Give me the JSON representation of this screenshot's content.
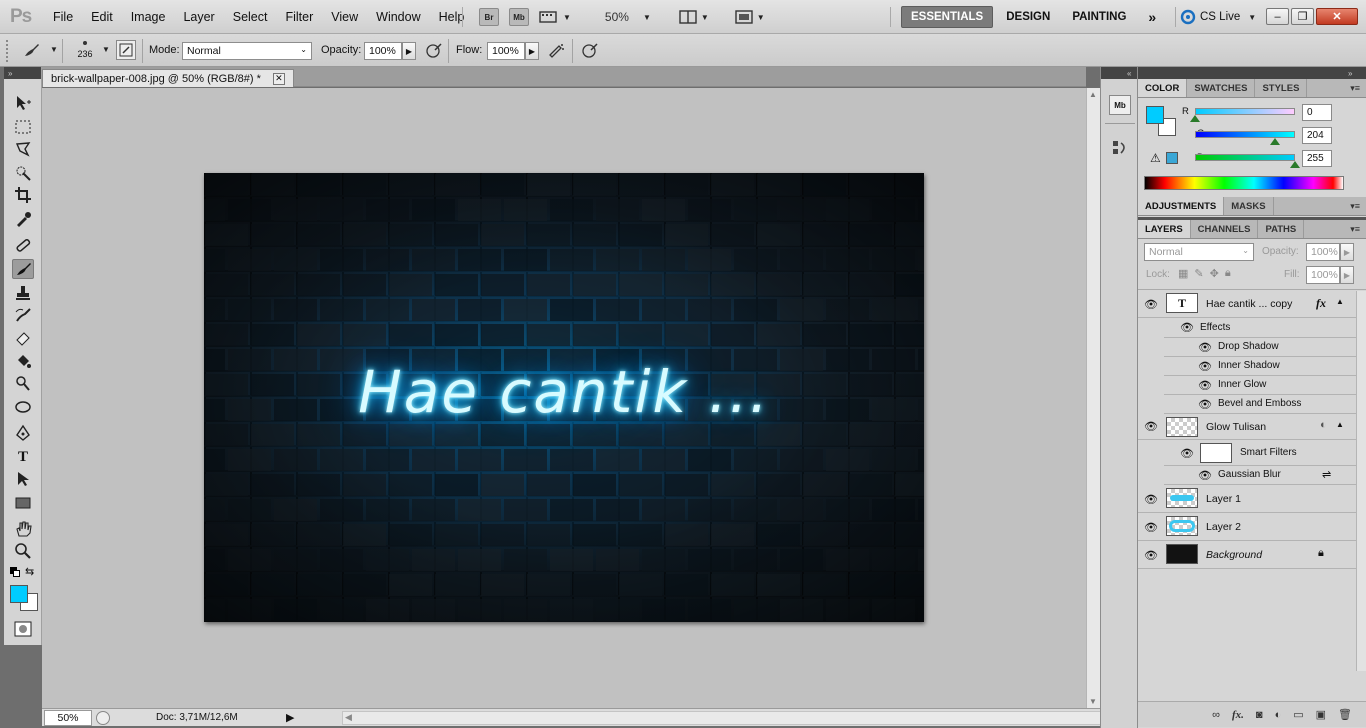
{
  "app": {
    "logo": "Ps"
  },
  "menu": [
    "File",
    "Edit",
    "Image",
    "Layer",
    "Select",
    "Filter",
    "View",
    "Window",
    "Help"
  ],
  "menubar": {
    "bridge_btn": "Br",
    "minibridge_btn": "Mb",
    "zoom": "50%",
    "workspaces": [
      "ESSENTIALS",
      "DESIGN",
      "PAINTING"
    ],
    "more": "»",
    "cslive": "CS Live",
    "window_buttons": [
      "–",
      "❐",
      "✕"
    ]
  },
  "options": {
    "brush_size": "236",
    "mode_label": "Mode:",
    "mode_value": "Normal",
    "opacity_label": "Opacity:",
    "opacity_value": "100%",
    "flow_label": "Flow:",
    "flow_value": "100%"
  },
  "document": {
    "tab_title": "brick-wallpaper-008.jpg @ 50% (RGB/8#) *",
    "close": "✕",
    "canvas_text": "Hae cantik ..."
  },
  "status": {
    "zoom": "50%",
    "doc_size": "Doc: 3,71M/12,6M"
  },
  "color_panel": {
    "tabs": [
      "COLOR",
      "SWATCHES",
      "STYLES"
    ],
    "r_label": "R",
    "r_value": "0",
    "r": 0,
    "g_label": "G",
    "g_value": "204",
    "g": 204,
    "b_label": "B",
    "b_value": "255",
    "b": 255,
    "fg_color": "#00ccff"
  },
  "adjustments_panel": {
    "tabs": [
      "ADJUSTMENTS",
      "MASKS"
    ]
  },
  "layers_panel": {
    "tabs": [
      "LAYERS",
      "CHANNELS",
      "PATHS"
    ],
    "blend_mode": "Normal",
    "opacity_label": "Opacity:",
    "opacity_value": "100%",
    "lock_label": "Lock:",
    "fill_label": "Fill:",
    "fill_value": "100%",
    "layers": [
      {
        "name": "Hae cantik ... copy",
        "fx": "fx",
        "thumb": "T"
      },
      {
        "name": "Effects"
      },
      {
        "name": "Drop Shadow"
      },
      {
        "name": "Inner Shadow"
      },
      {
        "name": "Inner Glow"
      },
      {
        "name": "Bevel and Emboss"
      },
      {
        "name": "Glow Tulisan"
      },
      {
        "name": "Smart Filters"
      },
      {
        "name": "Gaussian Blur"
      },
      {
        "name": "Layer 1"
      },
      {
        "name": "Layer 2"
      },
      {
        "name": "Background"
      }
    ]
  }
}
